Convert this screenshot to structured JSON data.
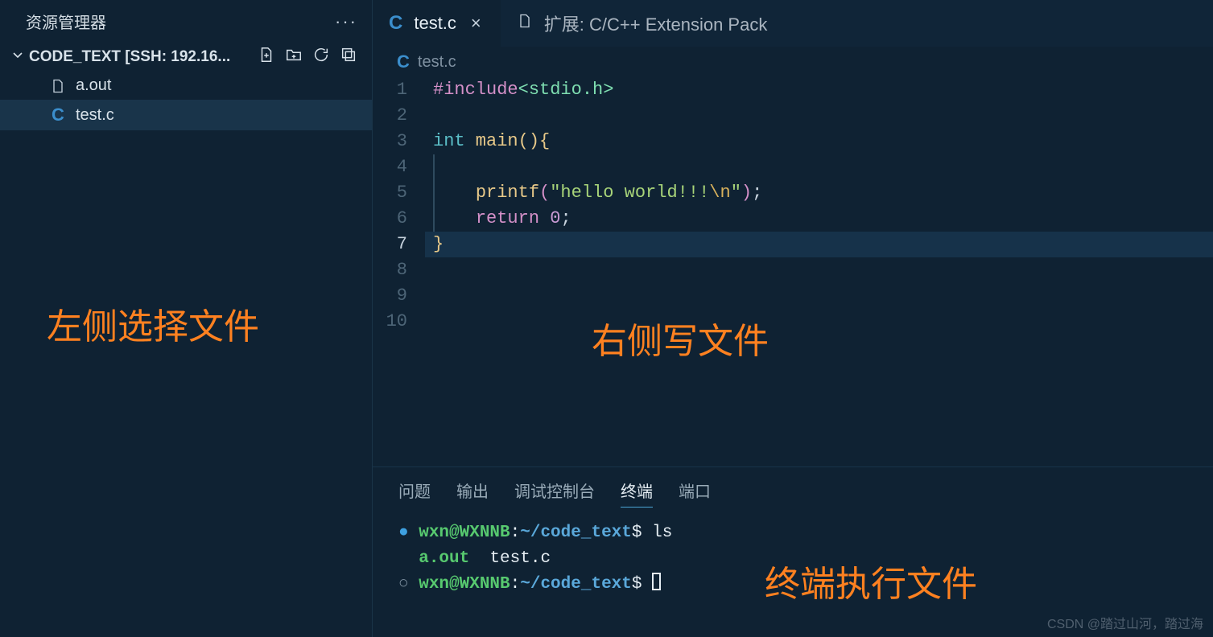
{
  "sidebar": {
    "title": "资源管理器",
    "folder_label": "CODE_TEXT [SSH: 192.16...",
    "files": [
      {
        "name": "a.out",
        "icon": "blank"
      },
      {
        "name": "test.c",
        "icon": "c"
      }
    ]
  },
  "tabs": [
    {
      "label": "test.c",
      "icon": "c",
      "active": true,
      "close": "×"
    },
    {
      "label": "扩展: C/C++ Extension Pack",
      "icon": "blank",
      "active": false
    }
  ],
  "breadcrumb": {
    "file": "test.c"
  },
  "code": {
    "lines": [
      "1",
      "2",
      "3",
      "4",
      "5",
      "6",
      "7",
      "8",
      "9",
      "10"
    ],
    "active_line": 7,
    "content": {
      "l1_directive": "#",
      "l1_include": "include",
      "l1_header": "<stdio.h>",
      "l3_type": "int",
      "l3_func": " main",
      "l3_open": "(){",
      "l5_func": "printf",
      "l5_open": "(",
      "l5_str": "\"hello world!!!",
      "l5_esc": "\\n",
      "l5_strend": "\"",
      "l5_close": ");",
      "l6_kw": "return",
      "l6_num": " 0",
      "l6_semi": ";",
      "l7_brace": "}"
    }
  },
  "panel": {
    "tabs": [
      "问题",
      "输出",
      "调试控制台",
      "终端",
      "端口"
    ],
    "active_tab": 3
  },
  "terminal": {
    "prompt_user": "wxn@WXNNB",
    "prompt_path": "~/code_text",
    "cmd1": "ls",
    "out_aout": "a.out",
    "out_testc": "  test.c"
  },
  "annotations": {
    "left": "左侧选择文件",
    "right": "右侧写文件",
    "bottom": "终端执行文件"
  },
  "watermark": "CSDN @踏过山河，踏过海"
}
